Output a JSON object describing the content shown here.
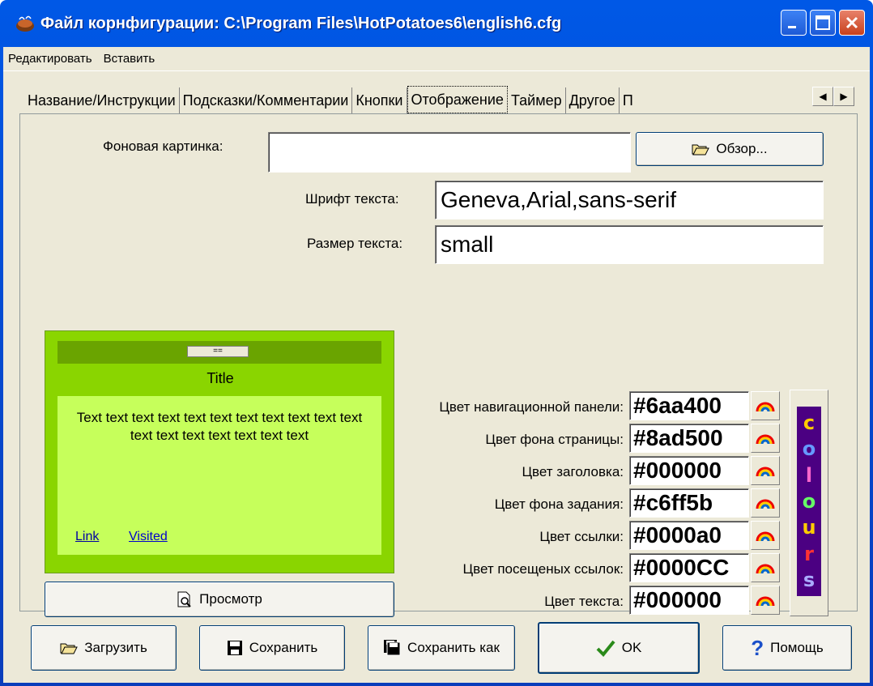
{
  "window": {
    "title": "Файл корнфигурации: C:\\Program Files\\HotPotatoes6\\english6.cfg"
  },
  "menu": [
    "Редактировать",
    "Вставить"
  ],
  "tabs": [
    {
      "label": "Название/Инструкции",
      "active": false
    },
    {
      "label": "Подсказки/Комментарии",
      "active": false
    },
    {
      "label": "Кнопки",
      "active": false
    },
    {
      "label": "Отображение",
      "active": true
    },
    {
      "label": "Таймер",
      "active": false
    },
    {
      "label": "Другое",
      "active": false
    },
    {
      "label": "П",
      "active": false
    }
  ],
  "display": {
    "bg_image_label": "Фоновая картинка:",
    "bg_image_value": "",
    "browse_label": "Обзор...",
    "font_label": "Шрифт текста:",
    "font_value": "Geneva,Arial,sans-serif",
    "size_label": "Размер текста:",
    "size_value": "small"
  },
  "preview": {
    "nav_button": "==",
    "title": "Title",
    "body": "Text text text text text text text text text text text text text text text text text text",
    "link": "Link",
    "visited": "Visited",
    "preview_button": "Просмотр"
  },
  "colors": [
    {
      "label": "Цвет навигационной панели:",
      "value": "#6aa400"
    },
    {
      "label": "Цвет фона страницы:",
      "value": "#8ad500"
    },
    {
      "label": "Цвет заголовка:",
      "value": "#000000"
    },
    {
      "label": "Цвет фона задания:",
      "value": "#c6ff5b"
    },
    {
      "label": "Цвет ссылки:",
      "value": "#0000a0"
    },
    {
      "label": "Цвет посещеных ссылок:",
      "value": "#0000CC"
    },
    {
      "label": "Цвет текста:",
      "value": "#000000"
    }
  ],
  "colours_badge": [
    "c",
    "o",
    "l",
    "o",
    "u",
    "r",
    "s"
  ],
  "buttons": {
    "load": "Загрузить",
    "save": "Сохранить",
    "save_as": "Сохранить как",
    "ok": "OK",
    "help": "Помощь"
  }
}
